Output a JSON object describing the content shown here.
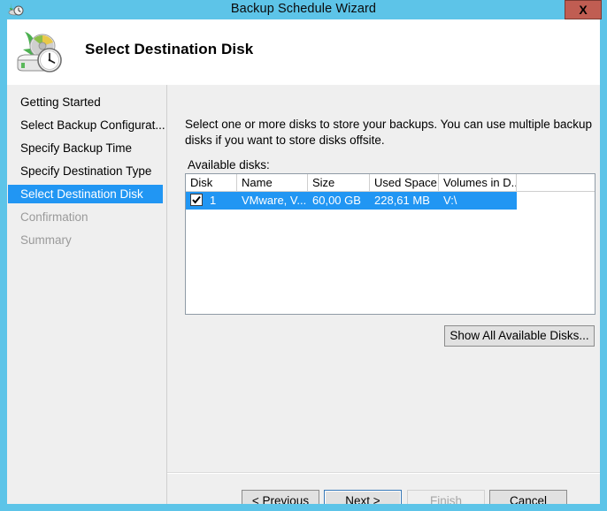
{
  "window": {
    "title": "Backup Schedule Wizard",
    "close_label": "X",
    "title_icon": "backup-schedule-icon"
  },
  "banner": {
    "heading": "Select Destination Disk",
    "icon": "disk-clock-backup-icon"
  },
  "sidebar": {
    "items": [
      {
        "label": "Getting Started",
        "state": "done"
      },
      {
        "label": "Select Backup Configurat...",
        "state": "done"
      },
      {
        "label": "Specify Backup Time",
        "state": "done"
      },
      {
        "label": "Specify Destination Type",
        "state": "done"
      },
      {
        "label": "Select Destination Disk",
        "state": "selected"
      },
      {
        "label": "Confirmation",
        "state": "disabled"
      },
      {
        "label": "Summary",
        "state": "disabled"
      }
    ]
  },
  "main": {
    "intro_text": "Select one or more disks to store your backups. You can use multiple backup disks if you want to store disks offsite.",
    "available_label": "Available disks:",
    "columns": [
      "Disk",
      "Name",
      "Size",
      "Used Space",
      "Volumes in D..."
    ],
    "rows": [
      {
        "checked": true,
        "disk": "1",
        "name": "VMware, V...",
        "size": "60,00 GB",
        "used_space": "228,61 MB",
        "volumes": "V:\\",
        "selected": true
      }
    ],
    "show_all_label": "Show All Available Disks..."
  },
  "footer": {
    "previous_label": "< Previous",
    "next_label": "Next >",
    "finish_label": "Finish",
    "cancel_label": "Cancel"
  },
  "colors": {
    "titlebar": "#5dc4e8",
    "accent_selection": "#2196f3",
    "close_button": "#c05d52",
    "body": "#efefef"
  }
}
